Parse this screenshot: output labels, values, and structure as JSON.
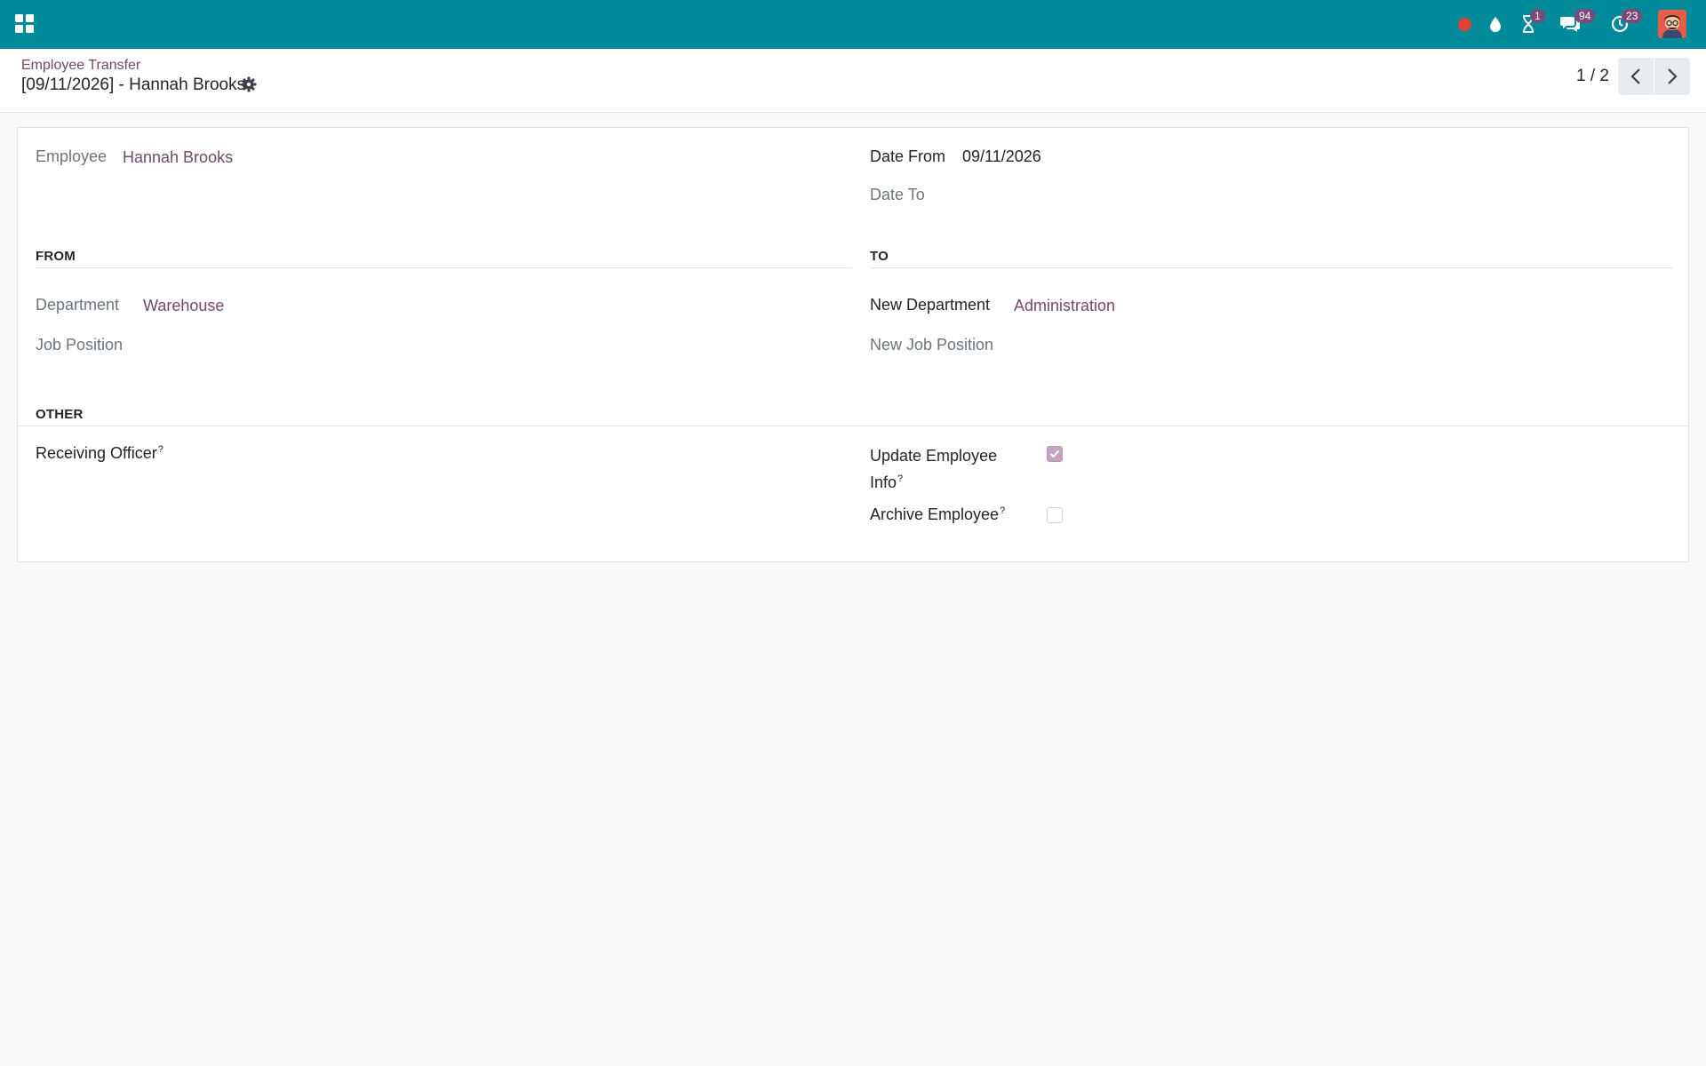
{
  "navbar": {
    "apps_icon": "apps-grid-icon",
    "systray": {
      "recording_icon": "record-dot-icon",
      "drop_icon": "water-drop-icon",
      "activities_icon": "hourglass-icon",
      "activities_count": "1",
      "messages_icon": "chat-bubbles-icon",
      "messages_count": "94",
      "clock_icon": "clock-icon",
      "clock_count": "23",
      "avatar_icon": "user-avatar"
    },
    "colors": {
      "bar": "#018a9a",
      "badge": "#7c4a78",
      "record": "#e0423a"
    }
  },
  "control_panel": {
    "breadcrumb": "Employee Transfer",
    "title": "[09/11/2026] - Hannah Brooks",
    "gear_icon": "gear-icon",
    "pager": {
      "value": "1 / 2",
      "prev_icon": "chevron-left-icon",
      "next_icon": "chevron-right-icon"
    }
  },
  "form": {
    "employee": {
      "label": "Employee",
      "value": "Hannah Brooks"
    },
    "date_from": {
      "label": "Date From",
      "value": "09/11/2026"
    },
    "date_to": {
      "label": "Date To",
      "value": ""
    },
    "from_section": {
      "title": "FROM",
      "department": {
        "label": "Department",
        "value": "Warehouse"
      },
      "job_position": {
        "label": "Job Position",
        "value": ""
      }
    },
    "to_section": {
      "title": "TO",
      "new_department": {
        "label": "New Department",
        "value": "Administration"
      },
      "new_job_position": {
        "label": "New Job Position",
        "value": ""
      }
    },
    "other_section": {
      "title": "OTHER",
      "receiving_officer": {
        "label": "Receiving Officer",
        "help": "?",
        "value": ""
      },
      "update_employee_info": {
        "label_line1": "Update Employee",
        "label_line2": "Info",
        "help": "?",
        "checked": true
      },
      "archive_employee": {
        "label": "Archive Employee",
        "help": "?",
        "checked": false
      }
    },
    "colors": {
      "link": "#714b67",
      "checkbox_checked": "#c4a5c0"
    }
  }
}
